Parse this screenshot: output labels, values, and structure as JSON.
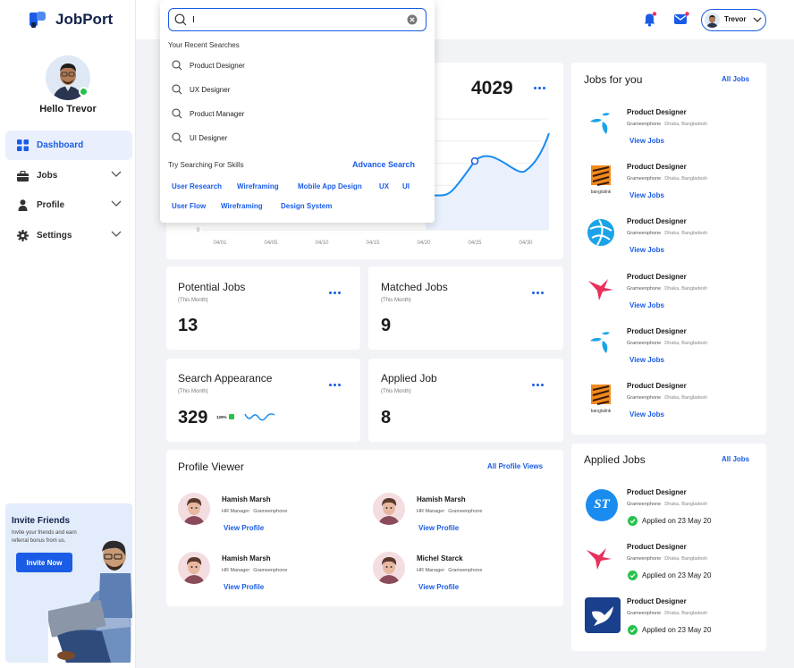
{
  "app": {
    "name": "JobPort"
  },
  "sidebar": {
    "greeting": "Hello Trevor",
    "items": [
      {
        "label": "Dashboard",
        "icon": "grid-icon",
        "active": true
      },
      {
        "label": "Jobs",
        "icon": "briefcase-icon"
      },
      {
        "label": "Profile",
        "icon": "person-icon"
      },
      {
        "label": "Settings",
        "icon": "gear-icon"
      }
    ],
    "invite": {
      "title": "Invite Friends",
      "subtitle": "Invite your friends and earn referral bonus from us.",
      "button": "Invite Now"
    }
  },
  "header": {
    "user_name": "Trevor"
  },
  "search": {
    "value": "I",
    "recent_heading": "Your Recent Searches",
    "recent": [
      "Product Designer",
      "UX Designer",
      "Product Manager",
      "UI Designer"
    ],
    "skills_heading": "Try Searching For Skills",
    "advance": "Advance Search",
    "skills": [
      "User Research",
      "Wireframing",
      "Mobile App Design",
      "UX",
      "UI",
      "User Flow",
      "Wireframing",
      "Design System"
    ]
  },
  "chart_card": {
    "value": "4029"
  },
  "chart_data": {
    "type": "area",
    "x": [
      "04/01",
      "04/05",
      "04/10",
      "04/15",
      "04/20",
      "04/25",
      "04/30"
    ],
    "y_tick_visible": "0",
    "series": [
      {
        "values": [
          null,
          null,
          null,
          null,
          30,
          62,
          68
        ]
      }
    ]
  },
  "stats": [
    {
      "title": "Potential Jobs",
      "sub": "(This Month)",
      "value": "13"
    },
    {
      "title": "Matched Jobs",
      "sub": "(This Month)",
      "value": "9"
    },
    {
      "title": "Search Appearance",
      "sub": "(This Month)",
      "value": "329",
      "badge": "125%"
    },
    {
      "title": "Applied Job",
      "sub": "(This Month)",
      "value": "8"
    }
  ],
  "profile_viewer": {
    "title": "Profile Viewer",
    "link": "All Profile Views",
    "people": [
      {
        "name": "Hamish Marsh",
        "role": "HR Manager",
        "company": "Grameenphone",
        "action": "View Profile"
      },
      {
        "name": "Hamish Marsh",
        "role": "HR Manager",
        "company": "Grameenphone",
        "action": "View Profile"
      },
      {
        "name": "Hamish Marsh",
        "role": "HR Manager",
        "company": "Grameenphone",
        "action": "View Profile"
      },
      {
        "name": "Michel Starck",
        "role": "HR Manager",
        "company": "Grameenphone",
        "action": "View Profile"
      }
    ]
  },
  "jobs_for_you": {
    "title": "Jobs for you",
    "link": "All Jobs",
    "items": [
      {
        "title": "Product Designer",
        "company": "Grameenphone",
        "location": "Dhaka, Bangladesh",
        "action": "View Jobs",
        "logo": "telenor-logo"
      },
      {
        "title": "Product Designer",
        "company": "Grameenphone",
        "location": "Dhaka, Bangladesh",
        "action": "View Jobs",
        "logo": "banglalink-logo",
        "logo_text": "banglalink"
      },
      {
        "title": "Product Designer",
        "company": "Grameenphone",
        "location": "Dhaka, Bangladesh",
        "action": "View Jobs",
        "logo": "globe-logo"
      },
      {
        "title": "Product Designer",
        "company": "Grameenphone",
        "location": "Dhaka, Bangladesh",
        "action": "View Jobs",
        "logo": "bird-logo"
      },
      {
        "title": "Product Designer",
        "company": "Grameenphone",
        "location": "Dhaka, Bangladesh",
        "action": "View Jobs",
        "logo": "telenor-logo"
      },
      {
        "title": "Product Designer",
        "company": "Grameenphone",
        "location": "Dhaka, Bangladesh",
        "action": "View Jobs",
        "logo": "banglalink-logo",
        "logo_text": "banglalink"
      }
    ]
  },
  "applied_jobs": {
    "title": "Applied Jobs",
    "link": "All Jobs",
    "items": [
      {
        "title": "Product Designer",
        "company": "Grameenphone",
        "location": "Dhaka, Bangladesh",
        "status": "Applied on 23 May 20",
        "logo": "st-logo",
        "logo_text": "ST"
      },
      {
        "title": "Product Designer",
        "company": "Grameenphone",
        "location": "Dhaka, Bangladesh",
        "status": "Applied on 23 May 20",
        "logo": "bird-logo"
      },
      {
        "title": "Product Designer",
        "company": "Grameenphone",
        "location": "Dhaka, Bangladesh",
        "status": "Applied on 23 May 20",
        "logo": "dove-logo"
      }
    ]
  },
  "colors": {
    "accent": "#1a5ce6",
    "success": "#27c24c",
    "background": "#f2f3f6"
  }
}
